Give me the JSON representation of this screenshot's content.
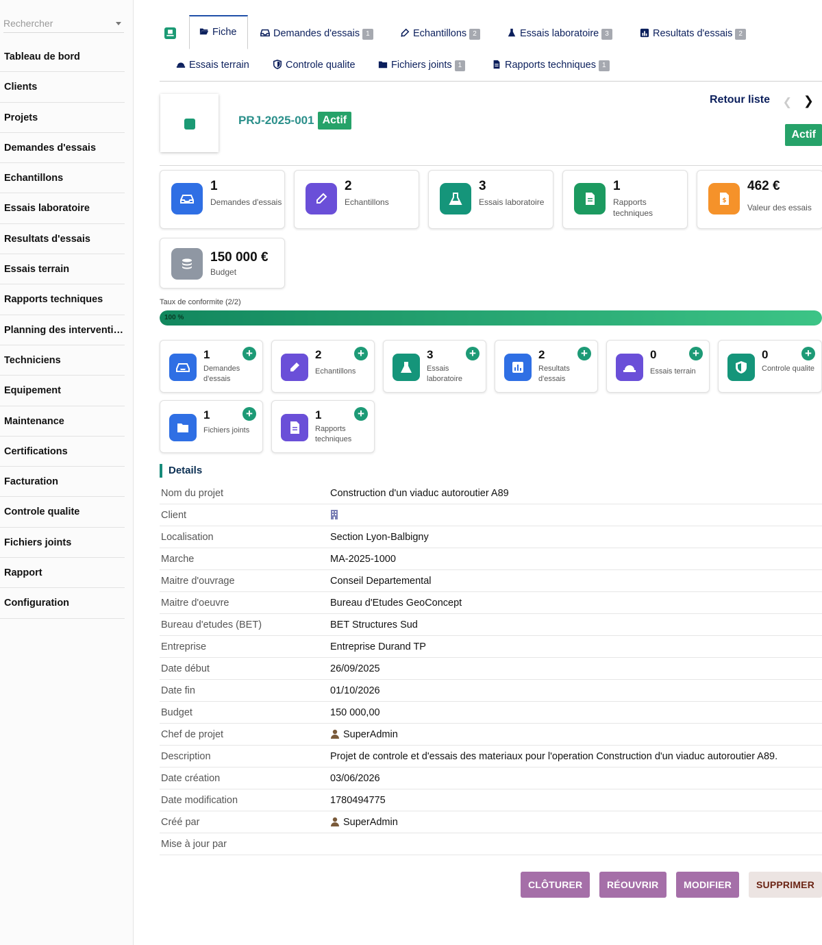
{
  "sidebar": {
    "search_placeholder": "Rechercher",
    "items": [
      "Tableau de bord",
      "Clients",
      "Projets",
      "Demandes d'essais",
      "Echantillons",
      "Essais laboratoire",
      "Resultats d'essais",
      "Essais terrain",
      "Rapports techniques",
      "Planning des interventi…",
      "Techniciens",
      "Equipement",
      "Maintenance",
      "Certifications",
      "Facturation",
      "Controle qualite",
      "Fichiers joints",
      "Rapport",
      "Configuration"
    ]
  },
  "tabs": {
    "fiche": "Fiche",
    "demandes": {
      "label": "Demandes d'essais",
      "count": "1"
    },
    "echantillons": {
      "label": "Echantillons",
      "count": "2"
    },
    "essais_labo": {
      "label": "Essais laboratoire",
      "count": "3"
    },
    "resultats": {
      "label": "Resultats d'essais",
      "count": "2"
    },
    "essais_terrain": "Essais terrain",
    "controle": "Controle qualite",
    "fichiers": {
      "label": "Fichiers joints",
      "count": "1"
    },
    "rapports": {
      "label": "Rapports techniques",
      "count": "1"
    }
  },
  "header": {
    "ref": "PRJ-2025-001",
    "status": "Actif",
    "back": "Retour liste",
    "status_right": "Actif"
  },
  "stats": [
    {
      "num": "1",
      "label": "Demandes d'essais",
      "color": "#2f6fe4",
      "icon": "inbox-icon"
    },
    {
      "num": "2",
      "label": "Echantillons",
      "color": "#6a4fd8",
      "icon": "eyedropper-icon"
    },
    {
      "num": "3",
      "label": "Essais laboratoire",
      "color": "#15957a",
      "icon": "flask-icon"
    },
    {
      "num": "1",
      "label": "Rapports techniques",
      "color": "#1c9a60",
      "icon": "document-icon"
    },
    {
      "num": "462 €",
      "label": "Valeur des essais",
      "color": "#f5922a",
      "icon": "invoice-icon"
    },
    {
      "num": "150 000 €",
      "label": "Budget",
      "color": "#8f97a3",
      "icon": "coins-icon"
    }
  ],
  "progress": {
    "label": "Taux de conformite (2/2)",
    "text": "100 %",
    "value": 100
  },
  "cards": [
    {
      "num": "1",
      "label": "Demandes d'essais",
      "color": "#2f6fe4",
      "icon": "inbox-icon"
    },
    {
      "num": "2",
      "label": "Echantillons",
      "color": "#6a4fd8",
      "icon": "eyedropper-icon"
    },
    {
      "num": "3",
      "label": "Essais laboratoire",
      "color": "#15957a",
      "icon": "flask-icon"
    },
    {
      "num": "2",
      "label": "Resultats d'essais",
      "color": "#2f6fe4",
      "icon": "chart-icon"
    },
    {
      "num": "0",
      "label": "Essais terrain",
      "color": "#6a4fd8",
      "icon": "hardhat-icon"
    },
    {
      "num": "0",
      "label": "Controle qualite",
      "color": "#15957a",
      "icon": "shield-icon"
    },
    {
      "num": "1",
      "label": "Fichiers joints",
      "color": "#2f6fe4",
      "icon": "folder-icon"
    },
    {
      "num": "1",
      "label": "Rapports techniques",
      "color": "#6a4fd8",
      "icon": "document-icon"
    }
  ],
  "details": {
    "title": "Details",
    "rows": [
      {
        "k": "Nom du projet",
        "v": "Construction d'un viaduc autoroutier A89"
      },
      {
        "k": "Client",
        "v": ""
      },
      {
        "k": "Localisation",
        "v": "Section Lyon-Balbigny"
      },
      {
        "k": "Marche",
        "v": "MA-2025-1000"
      },
      {
        "k": "Maitre d'ouvrage",
        "v": "Conseil Departemental"
      },
      {
        "k": "Maitre d'oeuvre",
        "v": "Bureau d'Etudes GeoConcept"
      },
      {
        "k": "Bureau d'etudes (BET)",
        "v": "BET Structures Sud"
      },
      {
        "k": "Entreprise",
        "v": "Entreprise Durand TP"
      },
      {
        "k": "Date début",
        "v": "26/09/2025"
      },
      {
        "k": "Date fin",
        "v": "01/10/2026"
      },
      {
        "k": "Budget",
        "v": "150 000,00"
      },
      {
        "k": "Chef de projet",
        "v": "SuperAdmin"
      },
      {
        "k": "Description",
        "v": "Projet de controle et d'essais des materiaux pour l'operation Construction d'un viaduc autoroutier A89."
      },
      {
        "k": "Date création",
        "v": "03/06/2026"
      },
      {
        "k": "Date modification",
        "v": "1780494775"
      },
      {
        "k": "Créé par",
        "v": "SuperAdmin"
      },
      {
        "k": "Mise à jour par",
        "v": ""
      }
    ]
  },
  "actions": {
    "cloturer": "CLÔTURER",
    "reouvrir": "RÉOUVRIR",
    "modifier": "MODIFIER",
    "supprimer": "SUPPRIMER"
  }
}
